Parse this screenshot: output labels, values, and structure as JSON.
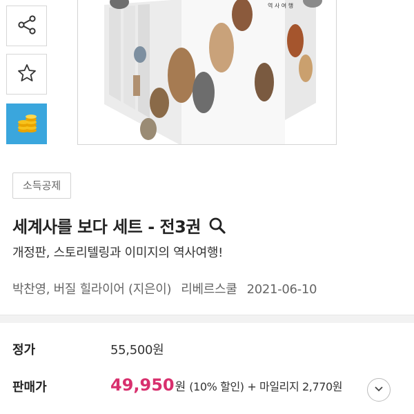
{
  "side_actions": [
    {
      "icon": "share-icon"
    },
    {
      "icon": "star-icon"
    },
    {
      "icon": "coins-icon"
    }
  ],
  "cover": {
    "spine_text": "역 사 여 행"
  },
  "badge": "소득공제",
  "product": {
    "title": "세계사를 보다 세트 - 전3권",
    "subtitle": "개정판, 스토리텔링과 이미지의 역사여행!",
    "authors": "박찬영, 버질 힐라이어 (지은이)",
    "publisher": "리베르스쿨",
    "date": "2021-06-10"
  },
  "price": {
    "list_label": "정가",
    "list_value": "55,500원",
    "sale_label": "판매가",
    "sale_value": "49,950",
    "sale_unit": "원",
    "sale_extra": "(10% 할인) + 마일리지 2,770원"
  },
  "colors": {
    "accent": "#d8306e",
    "coin_bg": "#3aa6dd"
  }
}
